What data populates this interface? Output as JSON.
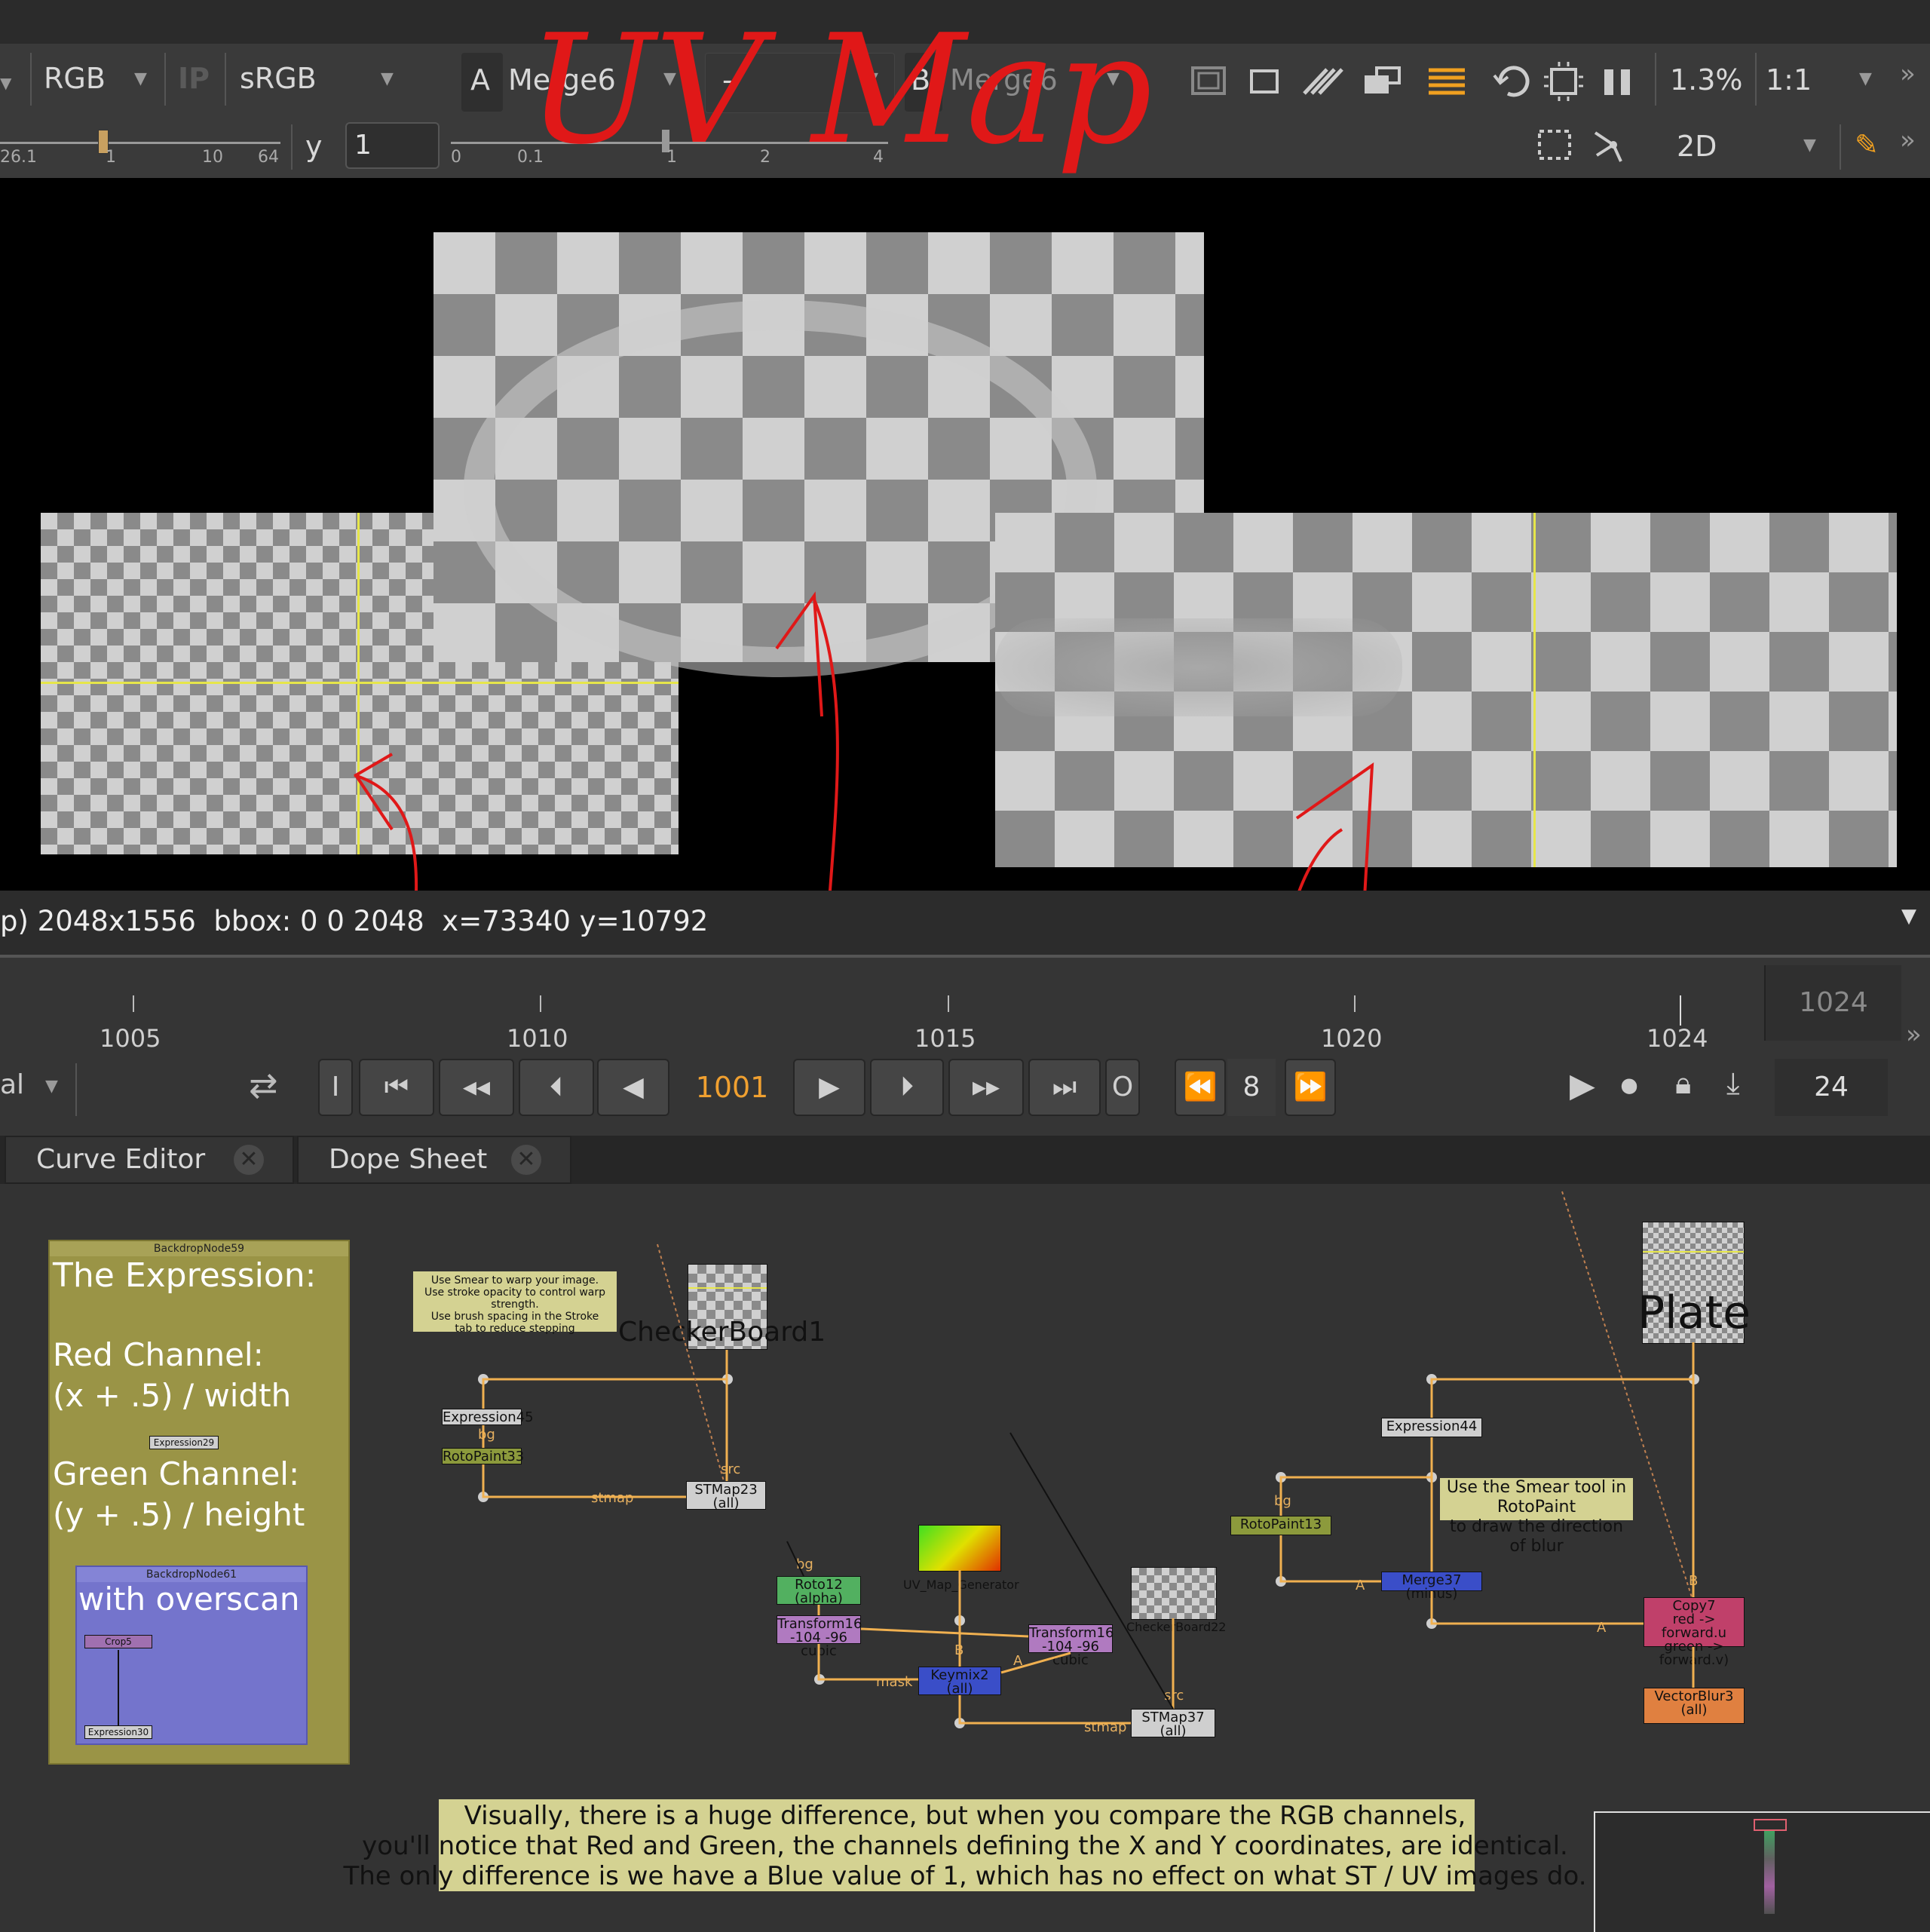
{
  "viewer": {
    "channels": "RGB",
    "ip_label": "IP",
    "colorspace": "sRGB",
    "input_a_label": "A",
    "input_a": "Merge6",
    "compare_mode": "-",
    "input_b_label": "B",
    "input_b": "Merge6",
    "zoom": "1.3%",
    "ratio": "1:1",
    "gain_ticks": [
      "26.1",
      "1",
      "10",
      "64"
    ],
    "gamma_label": "y",
    "gamma_value": "1",
    "gamma_ticks": [
      "0",
      "0.1",
      "1",
      "2",
      "4"
    ],
    "view_mode": "2D"
  },
  "annotation_title": "UV Map",
  "infobar": {
    "text": "p) 2048x1556  bbox: 0 0 2048  x=73340 y=10792"
  },
  "timeline": {
    "labels": [
      "1005",
      "1010",
      "1015",
      "1020",
      "1024"
    ],
    "end_frame": "1024"
  },
  "transport": {
    "mode_fragment": "al",
    "current_frame": "1001",
    "in_label": "I",
    "out_label": "O",
    "step": "8",
    "fps": "24"
  },
  "tabs": [
    {
      "label": "Curve Editor"
    },
    {
      "label": "Dope Sheet"
    }
  ],
  "dag": {
    "backdrop59": {
      "title": "BackdropNode59",
      "heading": "The Expression:",
      "red_label": "Red Channel:",
      "red_expr": "(x + .5) / width",
      "green_label": "Green Channel:",
      "green_expr": "(y + .5) / height",
      "expr_node": "Expression29"
    },
    "backdrop61": {
      "title": "BackdropNode61",
      "heading": "with overscan",
      "crop": "Crop5",
      "expr": "Expression30"
    },
    "group1": {
      "note_lines": [
        "Use Smear to warp your image.",
        "Use stroke opacity to control warp strength.",
        "Use brush spacing in the Stroke",
        "tab to reduce stepping"
      ],
      "checker": "CheckerBoard1",
      "expression": "Expression45",
      "bg": "bg",
      "rotopaint": "RotoPaint33",
      "src": "src",
      "stmap": "stmap",
      "stmap_node": "STMap23",
      "stmap_sub": "(all)"
    },
    "group2": {
      "bg": "bg",
      "roto": "Roto12",
      "roto_sub": "(alpha)",
      "transform_a": "Transform16",
      "transform_a_sub": "-104 -96   cubic",
      "generator": "UV_Map_Generator",
      "transform_b": "Transform16",
      "transform_b_sub": "-104 -96   cubic",
      "checker": "CheckerBoard22",
      "mask": "mask",
      "b": "B",
      "a": "A",
      "keymix": "Keymix2",
      "keymix_sub": "(all)",
      "src": "src",
      "stmap": "stmap",
      "stmap_node": "STMap37",
      "stmap_sub": "(all)"
    },
    "group3": {
      "plate": "Plate",
      "expression": "Expression44",
      "bg": "bg",
      "note_lines": [
        "Use the Smear tool in RotoPaint",
        "to draw the direction of blur"
      ],
      "rotopaint": "RotoPaint13",
      "a": "A",
      "merge": "Merge37 (minus)",
      "b": "B",
      "a2": "A",
      "copy": "Copy7",
      "copy_sub1": "red -> forward.u",
      "copy_sub2": "green -> forward.v)",
      "vblur": "VectorBlur3",
      "vblur_sub": "(all)"
    },
    "bottom_note": [
      "Visually, there is a huge difference, but when you compare the RGB channels,",
      "you'll notice that Red and Green, the channels defining the X and Y coordinates, are identical.",
      "The only difference is we have a Blue value of 1, which has no effect on what ST / UV images do."
    ]
  }
}
